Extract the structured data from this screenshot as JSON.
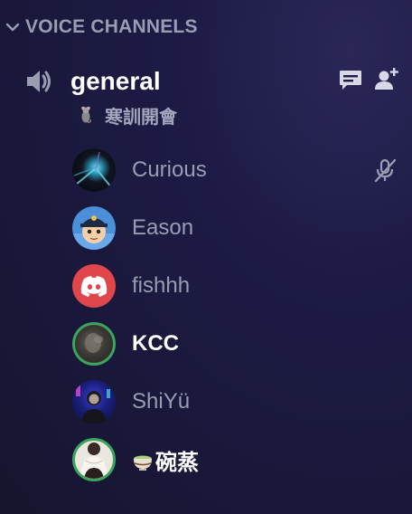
{
  "section": {
    "title": "VOICE CHANNELS"
  },
  "channel": {
    "name": "general",
    "status": "寒訓開會"
  },
  "members": [
    {
      "name": "Curious",
      "muted": true,
      "speaking": false
    },
    {
      "name": "Eason",
      "muted": false,
      "speaking": false
    },
    {
      "name": "fishhh",
      "muted": false,
      "speaking": false
    },
    {
      "name": "KCC",
      "muted": false,
      "speaking": true
    },
    {
      "name": "ShiYü",
      "muted": false,
      "speaking": false
    },
    {
      "name": "碗蒸",
      "muted": false,
      "speaking": true
    }
  ],
  "colors": {
    "speaking_ring": "#3ba55c",
    "discord_red": "#e0474c",
    "muted_text": "#9a9cb3",
    "active_text": "#ffffff"
  },
  "icons": {
    "section_toggle": "chevron-down-icon",
    "channel_type": "speaker-icon",
    "chat": "chat-bubble-icon",
    "invite": "add-user-icon",
    "member_muted": "mic-off-icon"
  }
}
